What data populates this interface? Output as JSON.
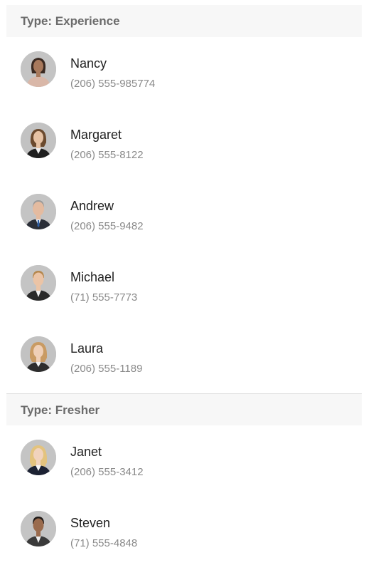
{
  "groups": [
    {
      "header": "Type: Experience",
      "items": [
        {
          "name": "Nancy",
          "phone": "(206) 555-985774",
          "avatar": "female-contact-avatar"
        },
        {
          "name": "Margaret",
          "phone": "(206) 555-8122",
          "avatar": "female-contact-avatar"
        },
        {
          "name": "Andrew",
          "phone": "(206) 555-9482",
          "avatar": "male-contact-avatar"
        },
        {
          "name": "Michael",
          "phone": "(71) 555-7773",
          "avatar": "male-contact-avatar"
        },
        {
          "name": "Laura",
          "phone": "(206) 555-1189",
          "avatar": "female-contact-avatar"
        }
      ]
    },
    {
      "header": "Type: Fresher",
      "items": [
        {
          "name": "Janet",
          "phone": "(206) 555-3412",
          "avatar": "female-contact-avatar"
        },
        {
          "name": "Steven",
          "phone": "(71) 555-4848",
          "avatar": "male-contact-avatar"
        }
      ]
    }
  ],
  "colors": {
    "header_bg": "#f7f7f7",
    "header_text": "#6b6b6b",
    "name_text": "#212121",
    "phone_text": "#8a8a8a",
    "avatar_bg": "#bdbdbd"
  }
}
